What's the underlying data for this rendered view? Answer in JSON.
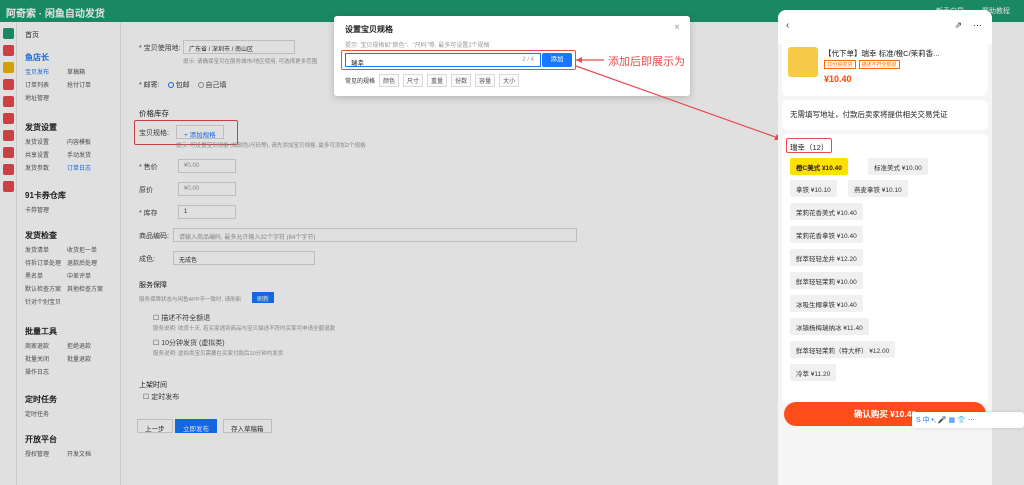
{
  "header": {
    "title": "阿奇索 · 闲鱼自动发货",
    "links": [
      "新手向导",
      "帮助教程"
    ]
  },
  "sidebar": {
    "home": "首页",
    "sections": [
      {
        "title": "鱼店长",
        "items": [
          "宝贝发布",
          "草稿箱",
          "订单列表",
          "抢付订单",
          "地址管理"
        ]
      },
      {
        "title": "发货设置",
        "items": [
          "发货设置",
          "内容模板",
          "共享设置",
          "手动发货",
          "发货参数",
          "订单日志"
        ]
      },
      {
        "title": "91卡券仓库",
        "items": [
          "卡券管理"
        ]
      },
      {
        "title": "发货检查",
        "items": [
          "发货清单",
          "收货拒一单",
          "待拆订单处理",
          "退款后处理",
          "黑名单",
          "中差评单",
          "默认检查方案",
          "其他检查方案",
          "针对个别宝贝"
        ]
      },
      {
        "title": "批量工具",
        "items": [
          "商家退款",
          "拒绝退款",
          "批量关闭",
          "批量退款",
          "操作日志"
        ]
      },
      {
        "title": "定时任务",
        "items": [
          "定时任务"
        ]
      },
      {
        "title": "开放平台",
        "items": [
          "授权管理",
          "开发文档"
        ]
      }
    ]
  },
  "form": {
    "location_label": "* 宝贝使用地:",
    "location_value": "广东省 / 深圳市 / 南山区",
    "location_hint": "提示: 请确保宝贝在服务城市/地区使用, 可选择更多范围",
    "shipping_label": "* 邮寄:",
    "shipping_opts": [
      "包邮",
      "自己填"
    ],
    "price_section": "价格库存",
    "spec_label": "宝贝规格:",
    "spec_button": "+ 添加规格",
    "spec_hint": "提示: 可设置宝贝规格 (如颜色/尺码等), 请先添加宝贝规格, 最多可添加2个规格",
    "price_label": "* 售价",
    "original_label": "原价",
    "stock_label": "* 库存",
    "stock_value": "1",
    "price_placeholder": "¥0.00",
    "code_label": "商品编码:",
    "code_placeholder": "请输入商品编码, 最多允许输入32个字符 (64个字节)",
    "condition_label": "成色:",
    "condition_value": "无成色",
    "service_title": "服务保障",
    "service_hint": "服务保障状态与闲鱼APP不一致时, 请刷新",
    "refresh": "刷新",
    "svc1": "描述不符全额退",
    "svc1_hint": "服务说明: 收货十天, 若买家遇到商品与宝贝描述不符时买家可申请全额退款",
    "svc2": "10分钟发货 (虚拟类)",
    "svc2_hint": "服务说明: 虚拟类宝贝需要在买家付款后10分钟内发货",
    "schedule_title": "上架时间",
    "schedule_opt": "定时发布",
    "btn_prev": "上一步",
    "btn_publish": "立即发布",
    "btn_draft": "存入草稿箱"
  },
  "modal": {
    "title": "设置宝贝规格",
    "close": "×",
    "hint": "提示: 宝贝规格如\"颜色\"、\"尺码\"等, 最多可设置2个规格",
    "input_value": "瑞幸",
    "count": "2 / 4",
    "add": "添加",
    "common_label": "常见的规格",
    "common_tags": [
      "颜色",
      "尺寸",
      "重量",
      "份数",
      "容量",
      "大小"
    ]
  },
  "annotation": "添加后即展示为",
  "phone": {
    "product_title": "【代下单】瑞幸 标准/橙C/茉莉香...",
    "tags": [
      "10分钟发货",
      "描述不符全额退"
    ],
    "price": "¥10.40",
    "notice": "无需填写地址，付款后卖家将提供相关交易凭证",
    "options_title": "瑞幸（12）",
    "options": [
      "橙C美式  ¥10.40",
      "标准美式  ¥10.00",
      "拿铁  ¥10.10",
      "燕麦拿铁  ¥10.10",
      "茉莉花香美式  ¥10.40",
      "茉莉花香拿铁  ¥10.40",
      "鲜萃轻轻龙井  ¥12.20",
      "鲜萃轻轻茉莉  ¥10.00",
      "冰吸生椰拿铁  ¥10.40",
      "冰镇杨梅瑞纳冰  ¥11.40",
      "鲜萃轻轻茉莉（特大杯）  ¥12.00",
      "冷萃  ¥11.20"
    ],
    "buy": "确认购买 ¥10.40"
  },
  "ime": "S 中 •, 🎤 ▦ 👕 ⋯"
}
